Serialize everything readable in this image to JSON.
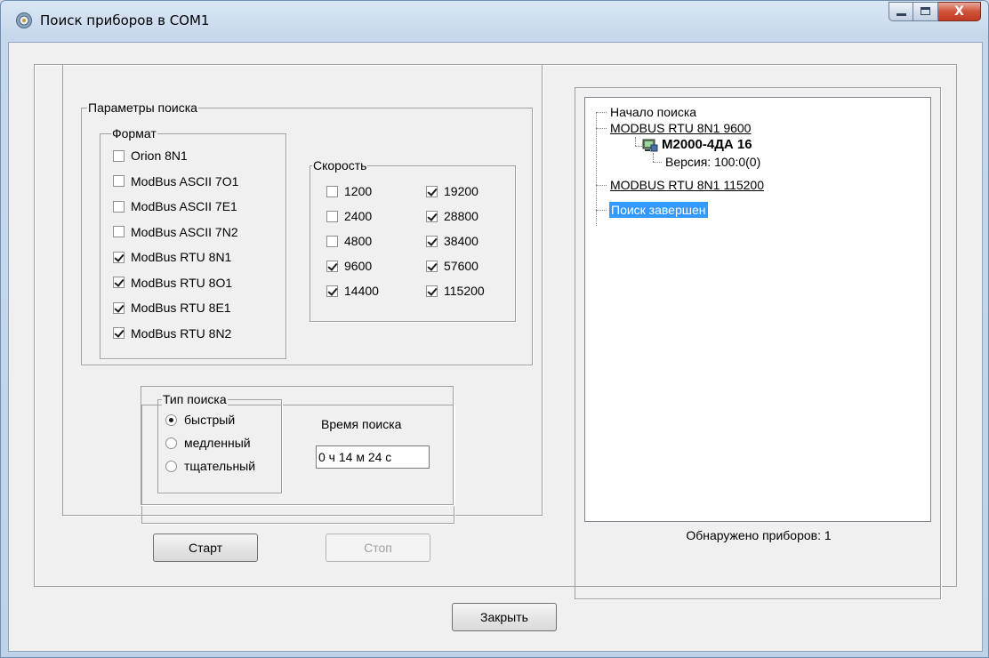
{
  "window": {
    "title": "Поиск приборов в COM1",
    "close_glyph": "X"
  },
  "search_params": {
    "legend": "Параметры поиска",
    "format": {
      "legend": "Формат",
      "items": [
        {
          "label": "Orion 8N1",
          "checked": false
        },
        {
          "label": "ModBus ASCII 7O1",
          "checked": false
        },
        {
          "label": "ModBus ASCII 7E1",
          "checked": false
        },
        {
          "label": "ModBus ASCII 7N2",
          "checked": false
        },
        {
          "label": "ModBus RTU 8N1",
          "checked": true
        },
        {
          "label": "ModBus RTU 8O1",
          "checked": true
        },
        {
          "label": "ModBus RTU 8E1",
          "checked": true
        },
        {
          "label": "ModBus RTU 8N2",
          "checked": true
        }
      ]
    },
    "speed": {
      "legend": "Скорость",
      "col1": [
        {
          "label": "1200",
          "checked": false
        },
        {
          "label": "2400",
          "checked": false
        },
        {
          "label": "4800",
          "checked": false
        },
        {
          "label": "9600",
          "checked": true
        },
        {
          "label": "14400",
          "checked": true
        }
      ],
      "col2": [
        {
          "label": "19200",
          "checked": true
        },
        {
          "label": "28800",
          "checked": true
        },
        {
          "label": "38400",
          "checked": true
        },
        {
          "label": "57600",
          "checked": true
        },
        {
          "label": "115200",
          "checked": true
        }
      ]
    }
  },
  "search_type": {
    "legend": "Тип поиска",
    "options": [
      {
        "label": "быстрый",
        "selected": true
      },
      {
        "label": "медленный",
        "selected": false
      },
      {
        "label": "тщательный",
        "selected": false
      }
    ],
    "time_label": "Время поиска",
    "time_value": "0 ч 14 м 24 с"
  },
  "buttons": {
    "start": "Старт",
    "stop": "Стоп",
    "close": "Закрыть"
  },
  "tree": {
    "root": "Начало поиска",
    "group1": "MODBUS RTU 8N1 9600",
    "device": "М2000-4ДА 16",
    "version": "Версия: 100:0(0)",
    "group2": "MODBUS RTU 8N1 115200",
    "finished": "Поиск завершен"
  },
  "found_label": "Обнаружено приборов: 1"
}
